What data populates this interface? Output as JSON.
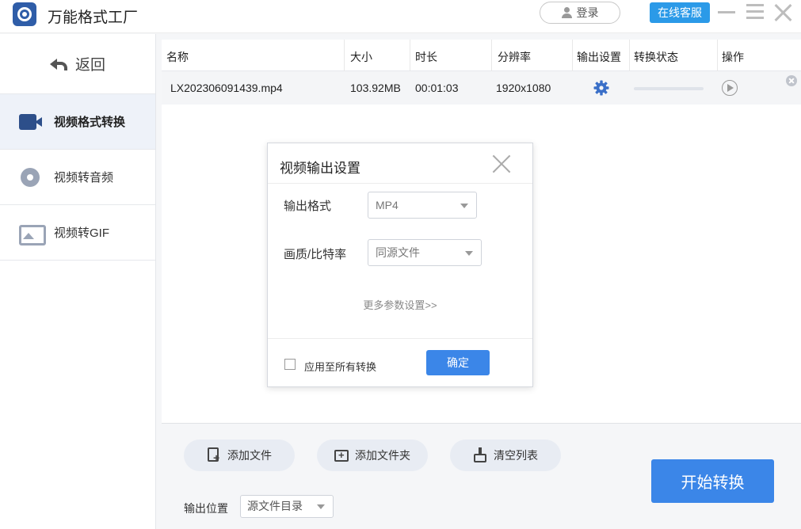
{
  "app": {
    "title": "万能格式工厂",
    "login_label": "登录",
    "service_label": "在线客服"
  },
  "sidebar": {
    "back_label": "返回",
    "items": [
      {
        "label": "视频格式转换",
        "icon": "video-convert-icon",
        "active": true
      },
      {
        "label": "视频转音频",
        "icon": "video-to-audio-icon",
        "active": false
      },
      {
        "label": "视频转GIF",
        "icon": "video-to-gif-icon",
        "active": false
      }
    ]
  },
  "table": {
    "columns": [
      "名称",
      "大小",
      "时长",
      "分辨率",
      "输出设置",
      "转换状态",
      "操作"
    ],
    "rows": [
      {
        "name": "LX202306091439.mp4",
        "size": "103.92MB",
        "duration": "00:01:03",
        "resolution": "1920x1080",
        "progress": 0
      }
    ]
  },
  "bottom": {
    "add_file_label": "添加文件",
    "add_folder_label": "添加文件夹",
    "clear_list_label": "清空列表",
    "start_label": "开始转换",
    "output_location_label": "输出位置",
    "output_location_value": "源文件目录"
  },
  "dialog": {
    "title": "视频输出设置",
    "format_label": "输出格式",
    "format_value": "MP4",
    "quality_label": "画质/比特率",
    "quality_value": "同源文件",
    "more_label": "更多参数设置>>",
    "apply_all_label": "应用至所有转换",
    "apply_all_checked": false,
    "ok_label": "确定"
  },
  "colors": {
    "primary": "#3b86e8",
    "service": "#2b9ae8",
    "active_nav_bg": "#eef2f9",
    "gear": "#3a6fc8"
  }
}
